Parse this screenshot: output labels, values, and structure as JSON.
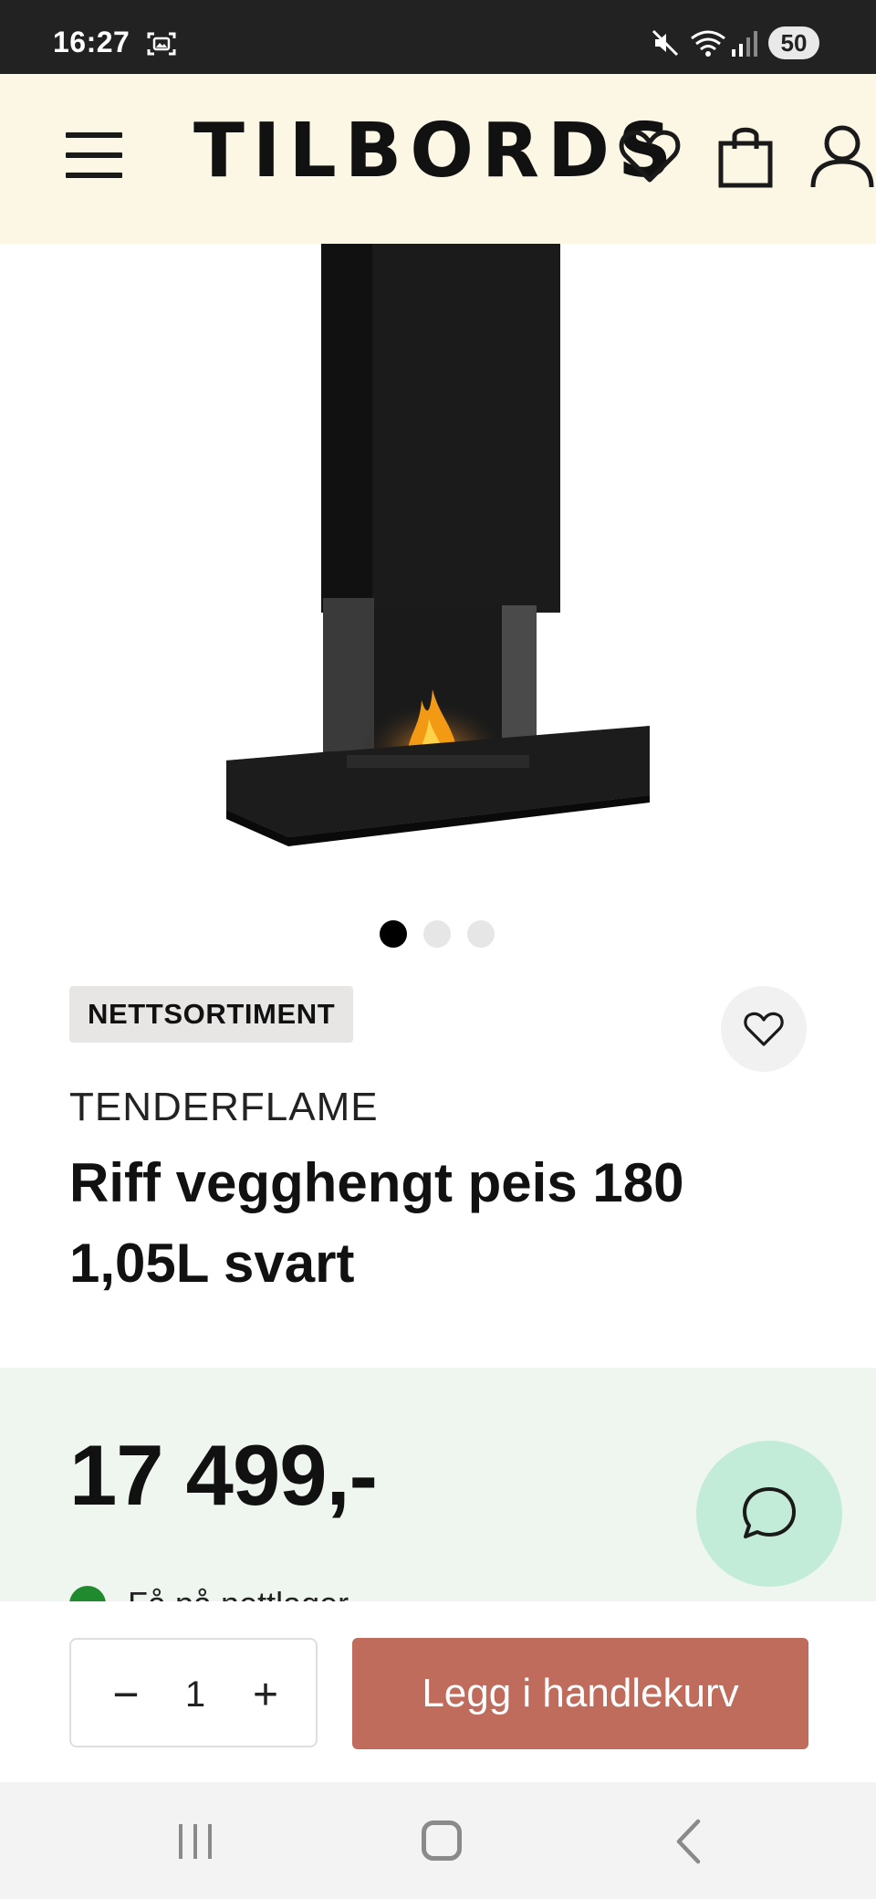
{
  "status_bar": {
    "time": "16:27",
    "battery": "50",
    "icons": [
      "screenshot-icon",
      "mute-icon",
      "wifi-icon",
      "signal-icon"
    ]
  },
  "header": {
    "logo": "TILBORDS",
    "icons": [
      "menu-icon",
      "heart-icon",
      "shopping-bag-icon",
      "user-icon"
    ],
    "background_color": "#fcf6e4"
  },
  "gallery": {
    "dot_count": 3,
    "active_index": 0
  },
  "product": {
    "badge": "NETTSORTIMENT",
    "brand": "TENDERFLAME",
    "title": "Riff vegghengt peis 180 1,05L svart",
    "price": "17 499,-",
    "stock_text": "Få på nettlager"
  },
  "purchase": {
    "quantity": "1",
    "minus_label": "−",
    "plus_label": "+",
    "add_to_cart_label": "Legg i handlekurv",
    "button_color": "#c06c5c"
  },
  "colors": {
    "price_section_bg": "#eef6ef",
    "chat_button_bg": "#c2ecd8",
    "stock_ok": "#1f8a2e"
  }
}
